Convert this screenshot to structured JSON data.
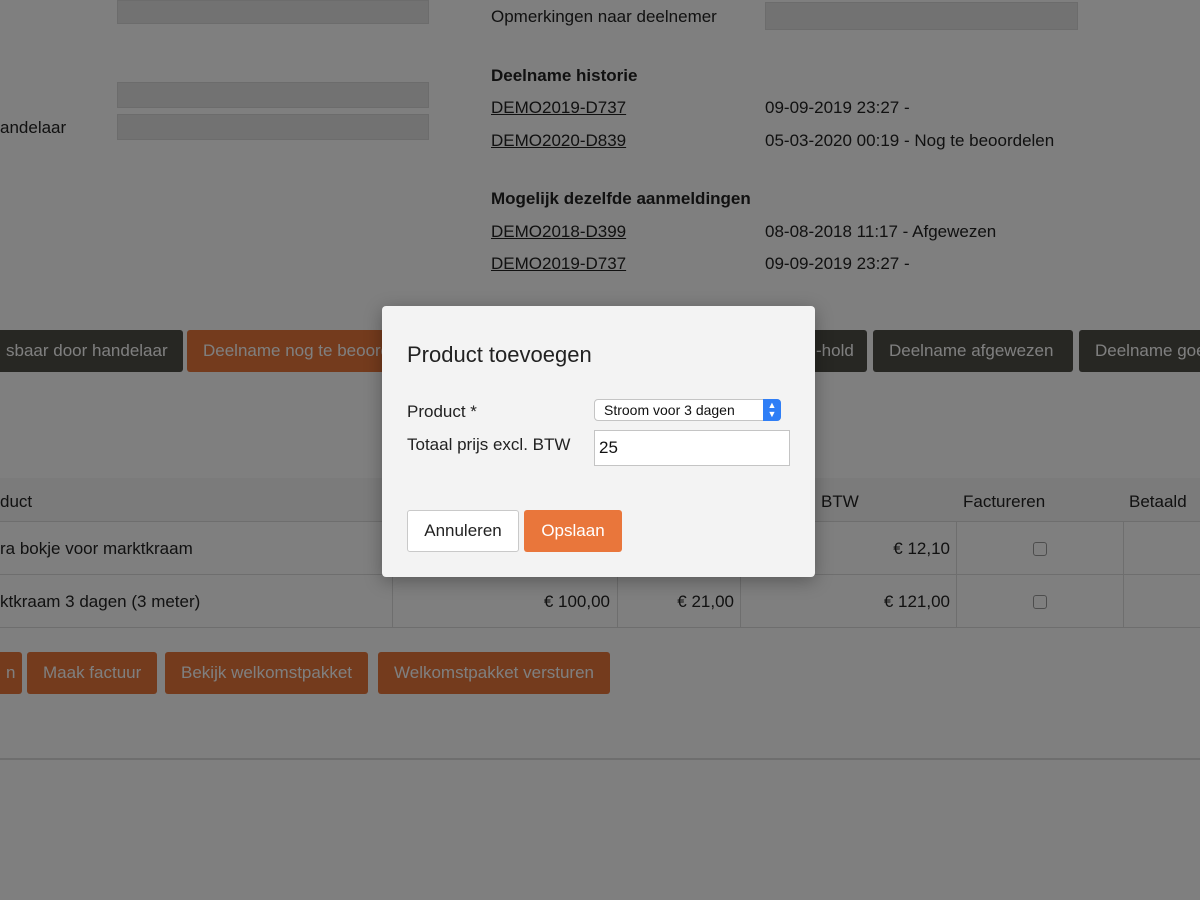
{
  "background": {
    "remarks_label": "Opmerkingen naar deelnemer",
    "left_label_partial": "andelaar",
    "history": {
      "heading": "Deelname historie",
      "rows": [
        {
          "code": "DEMO2019-D737",
          "info": "09-09-2019 23:27 -"
        },
        {
          "code": "DEMO2020-D839",
          "info": "05-03-2020 00:19 - Nog te beoordelen"
        }
      ]
    },
    "duplicates": {
      "heading": "Mogelijk dezelfde aanmeldingen",
      "rows": [
        {
          "code": "DEMO2018-D399",
          "info": "08-08-2018 11:17 - Afgewezen"
        },
        {
          "code": "DEMO2019-D737",
          "info": "09-09-2019 23:27 -"
        }
      ]
    },
    "status_buttons": [
      "sbaar door handelaar",
      "Deelname nog te beoordelen",
      "-hold",
      "Deelname afgewezen",
      "Deelname goedgekeurd"
    ],
    "table": {
      "headers": {
        "product": "duct",
        "btw": "BTW",
        "factureren": "Factureren",
        "betaald": "Betaald"
      },
      "rows": [
        {
          "product": "ra bokje voor marktkraam",
          "price": "",
          "vat": "",
          "total": "€ 12,10"
        },
        {
          "product": "ktkraam 3 dagen (3 meter)",
          "price": "€ 100,00",
          "vat": "€ 21,00",
          "total": "€ 121,00"
        }
      ]
    },
    "actions": [
      "n",
      "Maak factuur",
      "Bekijk welkomstpakket",
      "Welkomstpakket versturen"
    ]
  },
  "modal": {
    "title": "Product toevoegen",
    "product_label": "Product *",
    "product_selected": "Stroom voor 3 dagen",
    "price_label": "Totaal prijs excl. BTW",
    "price_value": "25",
    "cancel_label": "Annuleren",
    "save_label": "Opslaan"
  },
  "colors": {
    "accent": "#e9763b",
    "dark_button": "#4f4f47",
    "select_arrow": "#2f7ef6"
  }
}
